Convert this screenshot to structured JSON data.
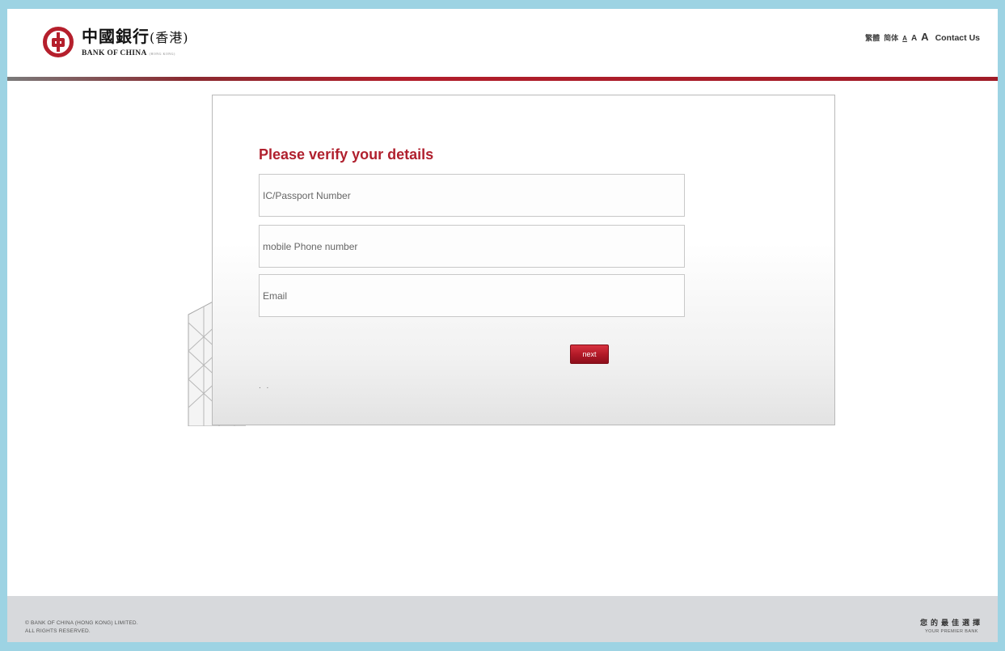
{
  "header": {
    "logo_cn": "中國銀行",
    "logo_cn_region": "(香港)",
    "logo_en": "BANK OF CHINA",
    "logo_en_region": "(HONG KONG)",
    "lang_traditional": "繁體",
    "lang_simplified": "简体",
    "font_small": "A",
    "font_medium": "A",
    "font_large": "A",
    "contact_label": "Contact Us"
  },
  "form": {
    "title": "Please verify your details",
    "ic_placeholder": "IC/Passport Number",
    "mobile_placeholder": "mobile Phone number",
    "email_placeholder": "Email",
    "next_label": "next",
    "dots": ". ."
  },
  "footer": {
    "copyright_line1": "© BANK OF CHINA (HONG KONG) LIMITED.",
    "copyright_line2": "ALL RIGHTS RESERVED.",
    "slogan_cn": "您的最佳選擇",
    "slogan_en": "YOUR PREMIER BANK"
  },
  "colors": {
    "brand_red": "#b0202e",
    "frame": "#9dd3e3",
    "footer_bg": "#d7d9dc"
  }
}
